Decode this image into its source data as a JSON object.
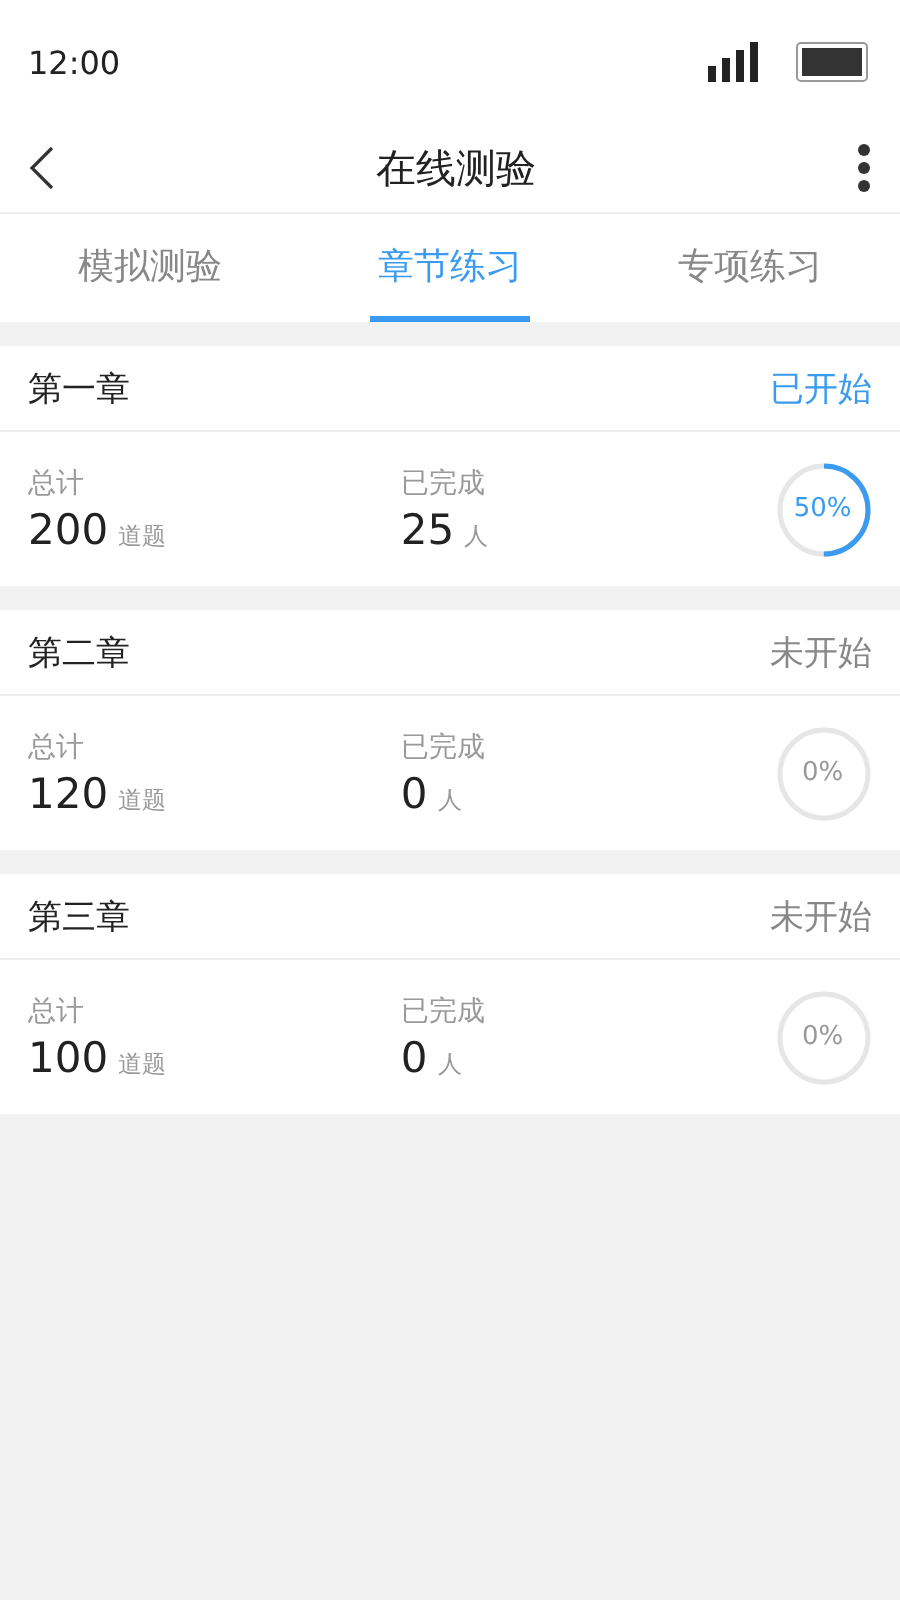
{
  "status_bar": {
    "time": "12:00"
  },
  "nav": {
    "title": "在线测验"
  },
  "tabs": [
    {
      "label": "模拟测验",
      "selected": false
    },
    {
      "label": "章节练习",
      "selected": true
    },
    {
      "label": "专项练习",
      "selected": false
    }
  ],
  "chapters": [
    {
      "title": "第一章",
      "status": "已开始",
      "started": true,
      "total_label": "总计",
      "total": "200",
      "total_unit": "道题",
      "done_label": "已完成",
      "done": "25",
      "done_unit": "人",
      "level": 0.5,
      "percent": "50%"
    },
    {
      "title": "第二章",
      "status": "未开始",
      "started": false,
      "total_label": "总计",
      "total": "120",
      "total_unit": "道题",
      "done_label": "已完成",
      "done": "0",
      "done_unit": "人",
      "level": 0,
      "percent": "0%"
    },
    {
      "title": "第三章",
      "status": "未开始",
      "started": false,
      "total_label": "总计",
      "total": "100",
      "total_unit": "道题",
      "done_label": "已完成",
      "done": "0",
      "done_unit": "人",
      "level": 0,
      "percent": "0%"
    }
  ]
}
